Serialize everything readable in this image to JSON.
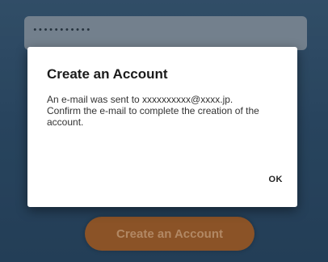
{
  "form": {
    "password_mask": "•••••••••••",
    "create_button_label": "Create an Account"
  },
  "dialog": {
    "title": "Create an Account",
    "message_line1": "An e-mail was sent to xxxxxxxxxx@xxxx.jp.",
    "message_line2": "Confirm the e-mail to complete the creation of the account.",
    "ok_label": "OK"
  },
  "colors": {
    "background": "#2f4f6d",
    "button_accent": "#a8612a",
    "dialog_bg": "#ffffff"
  }
}
